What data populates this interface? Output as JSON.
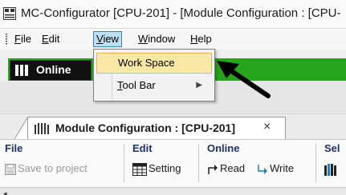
{
  "window": {
    "title": "MC-Configurator [CPU-201] - [Module Configuration : [CPU-"
  },
  "menubar": {
    "items": [
      {
        "label": "File",
        "underline": "F",
        "rest": "ile"
      },
      {
        "label": "Edit",
        "underline": "E",
        "rest": "dit"
      },
      {
        "label": "View",
        "underline": "V",
        "rest": "iew"
      },
      {
        "label": "Window",
        "underline": "W",
        "rest": "indow"
      },
      {
        "label": "Help",
        "underline": "H",
        "rest": "elp"
      }
    ]
  },
  "view_menu": {
    "items": [
      {
        "label": "Work Space",
        "highlighted": true
      },
      {
        "label": "Tool Bar",
        "underline": "T",
        "rest": "ool Bar",
        "submenu": true
      }
    ]
  },
  "toolbar": {
    "online_label": "Online",
    "status_color": "#26a51c"
  },
  "document_tab": {
    "label": "Module Configuration : [CPU-201]",
    "close": "×"
  },
  "ribbon": {
    "groups": [
      {
        "title": "File",
        "buttons": [
          {
            "label": "Save to project",
            "icon": "save-icon",
            "enabled": false
          }
        ]
      },
      {
        "title": "Edit",
        "buttons": [
          {
            "label": "Setting",
            "icon": "grid-icon",
            "enabled": true
          }
        ]
      },
      {
        "title": "Online",
        "buttons": [
          {
            "label": "Read",
            "icon": "read-arrow-icon",
            "enabled": true
          },
          {
            "label": "Write",
            "icon": "write-arrow-icon",
            "enabled": true
          }
        ]
      },
      {
        "title": "Sel",
        "buttons": [
          {
            "label": "",
            "icon": "module-icon",
            "enabled": true
          }
        ]
      }
    ]
  },
  "colors": {
    "menu_active_bg": "#bfe0f4",
    "dropdown_highlight": "#fbe7a6",
    "ribbon_title": "#1e2f6b"
  }
}
